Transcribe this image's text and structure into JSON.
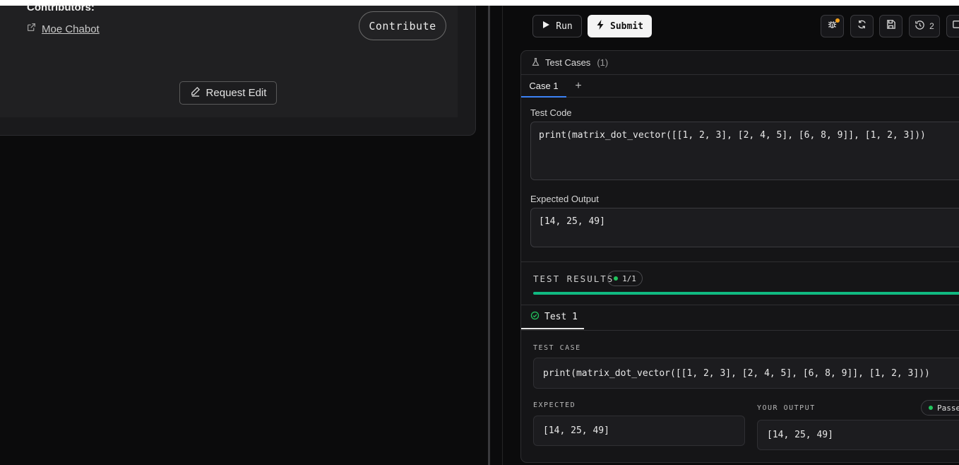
{
  "left": {
    "contributors_title": "Contributors:",
    "contributor_name": "Moe Chabot",
    "contribute_label": "Contribute",
    "request_edit_label": "Request Edit"
  },
  "toolbar": {
    "run_label": "Run",
    "submit_label": "Submit",
    "history_count": "2"
  },
  "test_cases": {
    "header_label": "Test Cases",
    "count": "(1)",
    "tab_label": "Case 1",
    "add_tab": "+",
    "test_code_label": "Test Code",
    "test_code": "print(matrix_dot_vector([[1, 2, 3], [2, 4, 5], [6, 8, 9]], [1, 2, 3]))",
    "expected_output_label": "Expected Output",
    "expected_output": "[14, 25, 49]"
  },
  "results": {
    "title": "TEST RESULTS",
    "badge": "1/1",
    "progress": 1.0,
    "progress_color": "#10b981",
    "tab_label": "Test 1",
    "test_case_label": "TEST CASE",
    "test_case_code": "print(matrix_dot_vector([[1, 2, 3], [2, 4, 5], [6, 8, 9]], [1, 2, 3]))",
    "expected_label": "EXPECTED",
    "expected_value": "[14, 25, 49]",
    "your_output_label": "YOUR OUTPUT",
    "your_output_value": "[14, 25, 49]",
    "status": "Passed",
    "status_color": "#22c55e"
  }
}
